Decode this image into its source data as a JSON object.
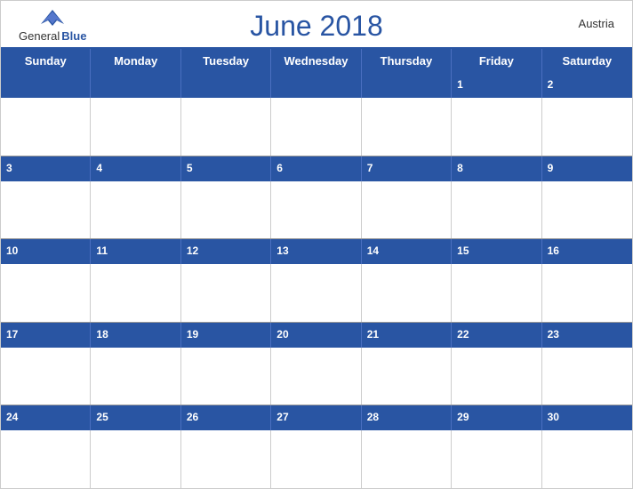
{
  "header": {
    "title": "June 2018",
    "country": "Austria",
    "logo": {
      "general": "General",
      "blue": "Blue"
    }
  },
  "days": {
    "headers": [
      "Sunday",
      "Monday",
      "Tuesday",
      "Wednesday",
      "Thursday",
      "Friday",
      "Saturday"
    ]
  },
  "weeks": [
    {
      "header_numbers": [
        "",
        "",
        "",
        "",
        "",
        "1",
        "2"
      ],
      "has_content": true
    },
    {
      "header_numbers": [
        "3",
        "4",
        "5",
        "6",
        "7",
        "8",
        "9"
      ],
      "has_content": true
    },
    {
      "header_numbers": [
        "10",
        "11",
        "12",
        "13",
        "14",
        "15",
        "16"
      ],
      "has_content": true
    },
    {
      "header_numbers": [
        "17",
        "18",
        "19",
        "20",
        "21",
        "22",
        "23"
      ],
      "has_content": true
    },
    {
      "header_numbers": [
        "24",
        "25",
        "26",
        "27",
        "28",
        "29",
        "30"
      ],
      "has_content": true
    }
  ],
  "colors": {
    "primary_blue": "#2955a3",
    "header_blue": "#2955a3",
    "border": "#ccc"
  }
}
